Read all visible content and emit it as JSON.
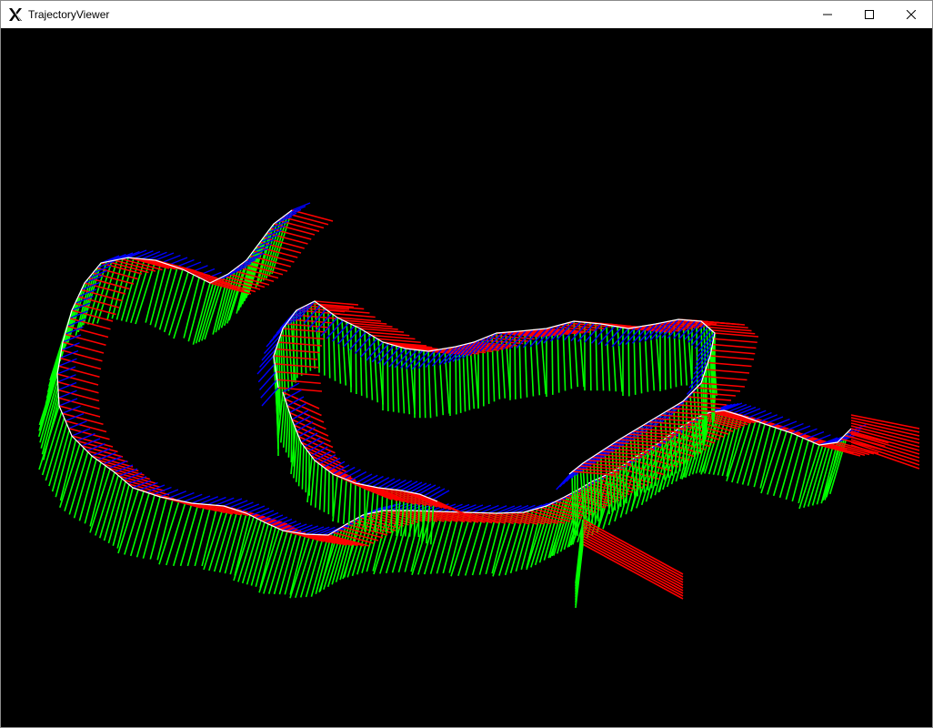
{
  "window": {
    "title": "TrajectoryViewer",
    "minimize_icon": "minimize-icon",
    "maximize_icon": "maximize-icon",
    "close_icon": "close-icon",
    "app_icon": "x-logo-icon"
  },
  "viewport": {
    "background": "#000000"
  },
  "colors": {
    "path": "#ffffff",
    "axis_x": "#ff0000",
    "axis_y": "#00ff00",
    "axis_z": "#0000ff"
  }
}
